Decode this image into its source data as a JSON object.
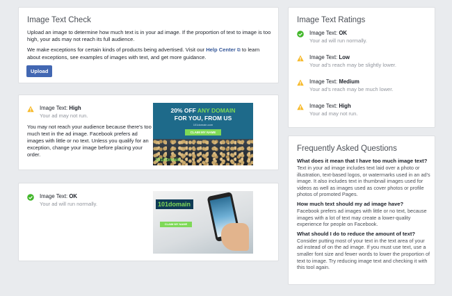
{
  "check": {
    "title": "Image Text Check",
    "desc1": "Upload an image to determine how much text is in your ad image. If the proportion of text to image is too high, your ads may not reach its full audience.",
    "desc2_pre": "We make exceptions for certain kinds of products being advertised. Visit our ",
    "help_link": "Help Center",
    "desc2_post": " to learn about exceptions, see examples of images with text, and get more guidance.",
    "upload_label": "Upload"
  },
  "result_high": {
    "label": "Image Text: ",
    "rating": "High",
    "sub": "Your ad may not run.",
    "body": "You may not reach your audience because there's too much text in the ad image. Facebook prefers ad images with little or no text. Unless you qualify for an exception, change your image before placing your order.",
    "ad": {
      "headline1": "20% OFF",
      "headline2": "ANY DOMAIN",
      "headline3": "FOR YOU, FROM US",
      "small": "101domain.com",
      "cta": "CLAIM MY NAME",
      "logo": "101domain"
    }
  },
  "result_ok": {
    "label": "Image Text: ",
    "rating": "OK",
    "sub": "Your ad will run normally.",
    "ad": {
      "logo": "101domain",
      "cta": "CLAIM MY NAME"
    }
  },
  "ratings": {
    "title": "Image Text Ratings",
    "items": [
      {
        "label": "Image Text: ",
        "rating": "OK",
        "desc": "Your ad will run normally.",
        "icon": "check-circle-icon",
        "color": "#42b72a"
      },
      {
        "label": "Image Text: ",
        "rating": "Low",
        "desc": "Your ad's reach may be slightly lower.",
        "icon": "warning-icon",
        "color": "#f7b928"
      },
      {
        "label": "Image Text: ",
        "rating": "Medium",
        "desc": "Your ad's reach may be much lower.",
        "icon": "warning-icon",
        "color": "#f7b928"
      },
      {
        "label": "Image Text: ",
        "rating": "High",
        "desc": "Your ad may not run.",
        "icon": "warning-icon",
        "color": "#f7b928"
      }
    ]
  },
  "faq": {
    "title": "Frequently Asked Questions",
    "items": [
      {
        "q": "What does it mean that I have too much image text?",
        "a": "Text in your ad image includes text laid over a photo or illustration, text-based logos, or watermarks used in an ad's image. It also includes text in thumbnail images used for videos as well as images used as cover photos or profile photos of promoted Pages."
      },
      {
        "q": "How much text should my ad image have?",
        "a": "Facebook prefers ad images with little or no text, because images with a lot of text may create a lower-quality experience for people on Facebook."
      },
      {
        "q": "What should I do to reduce the amount of text?",
        "a": "Consider putting most of your text in the text area of your ad instead of on the ad image. If you must use text, use a smaller font size and fewer words to lower the proportion of text to image. Try reducing image text and checking it with this tool again."
      }
    ]
  },
  "colors": {
    "accent": "#4267b2",
    "ok": "#42b72a",
    "warn": "#f7b928"
  }
}
